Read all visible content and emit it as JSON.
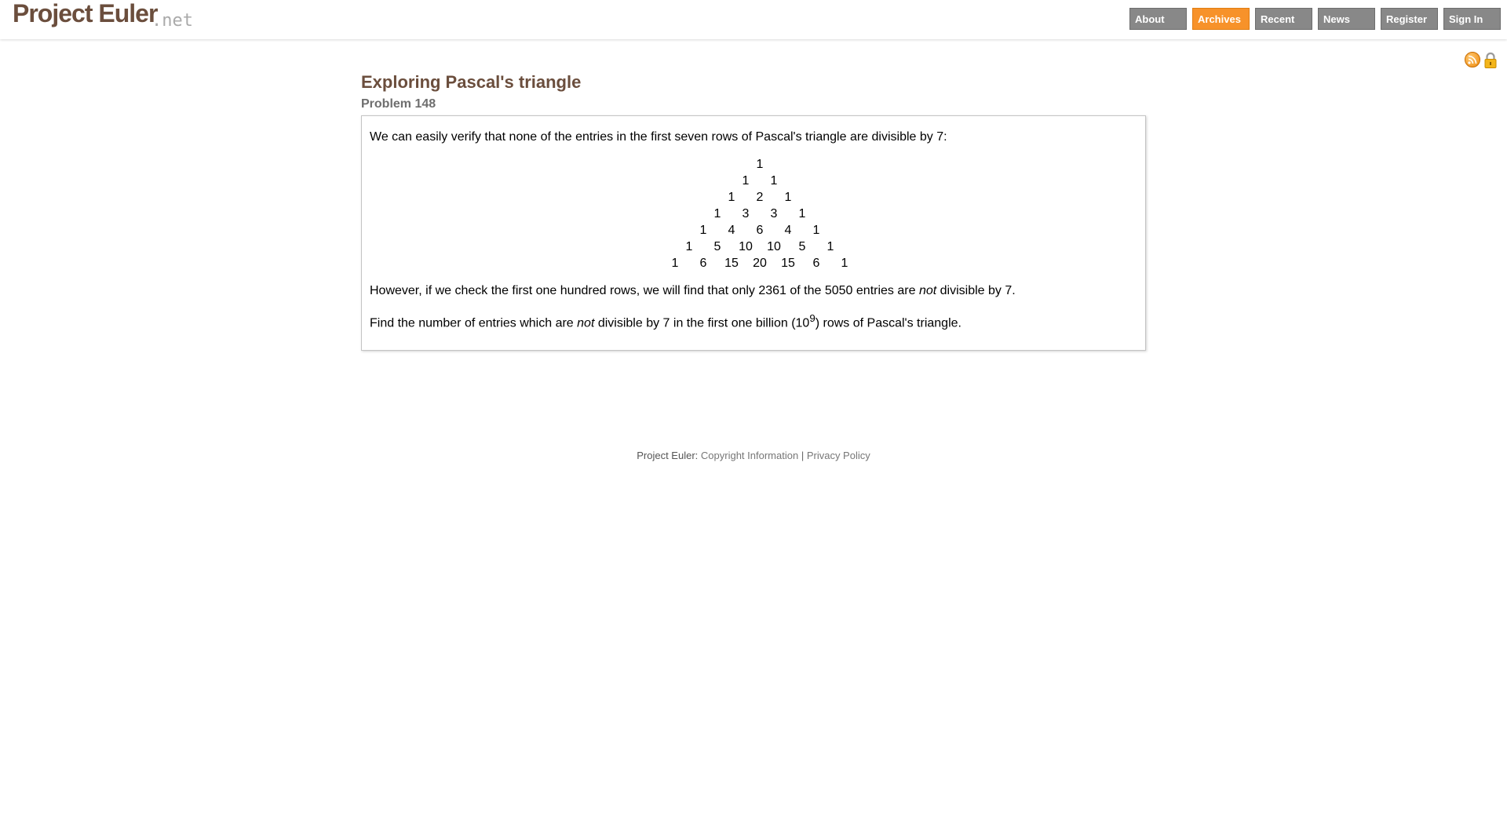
{
  "header": {
    "logo_main": "Project Euler",
    "logo_suffix": ".net",
    "nav": [
      {
        "label": "About",
        "active": false
      },
      {
        "label": "Archives",
        "active": true
      },
      {
        "label": "Recent",
        "active": false
      },
      {
        "label": "News",
        "active": false
      },
      {
        "label": "Register",
        "active": false
      },
      {
        "label": "Sign In",
        "active": false
      }
    ],
    "accent_color": "#f7922a",
    "brand_color": "#6b4e3d"
  },
  "icons": [
    "rss-feed-icon",
    "lock-icon"
  ],
  "problem": {
    "title": "Exploring Pascal's triangle",
    "number": "Problem 148",
    "intro": "We can easily verify that none of the entries in the first seven rows of Pascal's triangle are divisible by 7:",
    "triangle": [
      [
        "1"
      ],
      [
        "1",
        "1"
      ],
      [
        "1",
        "2",
        "1"
      ],
      [
        "1",
        "3",
        "3",
        "1"
      ],
      [
        "1",
        "4",
        "6",
        "4",
        "1"
      ],
      [
        "1",
        "5",
        "10",
        "10",
        "5",
        "1"
      ],
      [
        "1",
        "6",
        "15",
        "20",
        "15",
        "6",
        "1"
      ]
    ],
    "para2": {
      "before": "However, if we check the first one hundred rows, we will find that only 2361 of the 5050 entries are ",
      "em": "not",
      "after": " divisible by 7."
    },
    "para3": {
      "before": "Find the number of entries which are ",
      "em": "not",
      "middle": " divisible by 7 in the first one billion (10",
      "sup": "9",
      "after": ") rows of Pascal's triangle."
    }
  },
  "footer": {
    "brand": "Project Euler:",
    "copyright": "Copyright Information",
    "separator": "|",
    "privacy": "Privacy Policy"
  }
}
